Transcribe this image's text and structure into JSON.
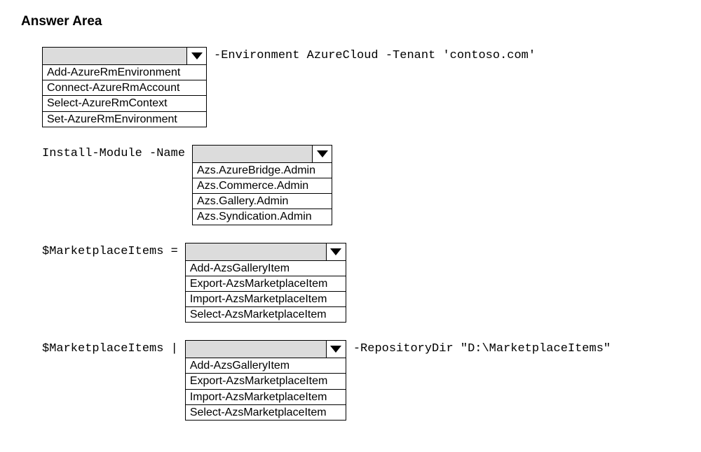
{
  "title": "Answer Area",
  "row1": {
    "suffix": "-Environment AzureCloud -Tenant 'contoso.com'",
    "options": [
      "Add-AzureRmEnvironment",
      "Connect-AzureRmAccount",
      "Select-AzureRmContext",
      "Set-AzureRmEnvironment"
    ]
  },
  "row2": {
    "prefix": "Install-Module -Name",
    "options": [
      "Azs.AzureBridge.Admin",
      "Azs.Commerce.Admin",
      "Azs.Gallery.Admin",
      "Azs.Syndication.Admin"
    ]
  },
  "row3": {
    "prefix": "$MarketplaceItems =",
    "options": [
      "Add-AzsGalleryItem",
      "Export-AzsMarketplaceItem",
      "Import-AzsMarketplaceItem",
      "Select-AzsMarketplaceItem"
    ]
  },
  "row4": {
    "prefix": "$MarketplaceItems |",
    "suffix": "-RepositoryDir \"D:\\MarketplaceItems\"",
    "options": [
      "Add-AzsGalleryItem",
      "Export-AzsMarketplaceItem",
      "Import-AzsMarketplaceItem",
      "Select-AzsMarketplaceItem"
    ]
  }
}
